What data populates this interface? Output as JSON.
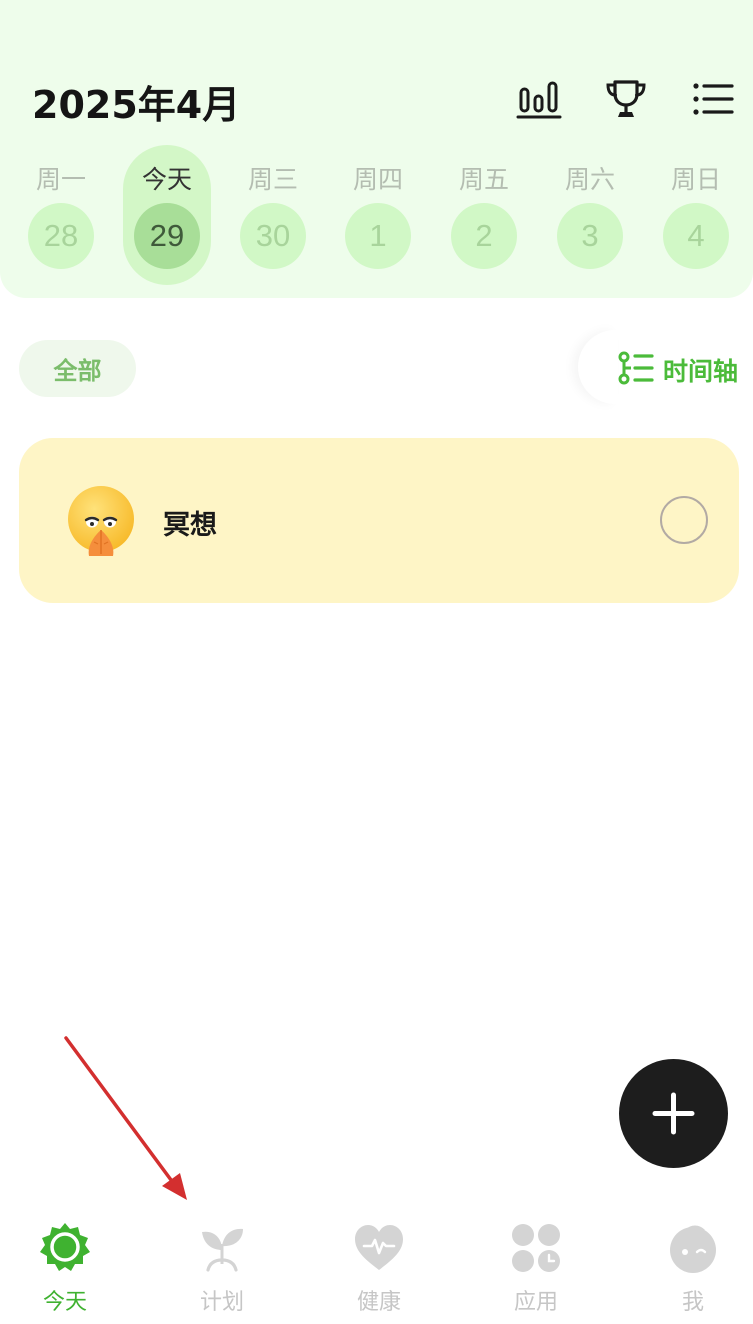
{
  "header": {
    "month_title": "2025年4月",
    "icons": [
      "bar-chart-icon",
      "trophy-icon",
      "list-icon"
    ]
  },
  "week": {
    "days": [
      {
        "name": "周一",
        "date": "28"
      },
      {
        "name": "今天",
        "date": "29"
      },
      {
        "name": "周三",
        "date": "30"
      },
      {
        "name": "周四",
        "date": "1"
      },
      {
        "name": "周五",
        "date": "2"
      },
      {
        "name": "周六",
        "date": "3"
      },
      {
        "name": "周日",
        "date": "4"
      }
    ],
    "selected_index": 1
  },
  "filters": {
    "all_label": "全部",
    "timeline_label": "时间轴"
  },
  "tasks": [
    {
      "title": "冥想",
      "icon": "meditation-emoji-icon",
      "completed": false
    }
  ],
  "fab": {
    "icon": "plus-icon"
  },
  "bottom_nav": {
    "items": [
      {
        "label": "今天",
        "icon": "sun-badge-icon",
        "active": true
      },
      {
        "label": "计划",
        "icon": "sprout-icon",
        "active": false
      },
      {
        "label": "健康",
        "icon": "heart-pulse-icon",
        "active": false
      },
      {
        "label": "应用",
        "icon": "apps-grid-icon",
        "active": false
      },
      {
        "label": "我",
        "icon": "profile-face-icon",
        "active": false
      }
    ]
  },
  "colors": {
    "accent_green": "#4bbb3a",
    "header_bg": "#eefdeb",
    "task_card_bg": "#fef5c6",
    "fab_bg": "#1d1d1d",
    "annotation_arrow": "#d32f2f"
  }
}
